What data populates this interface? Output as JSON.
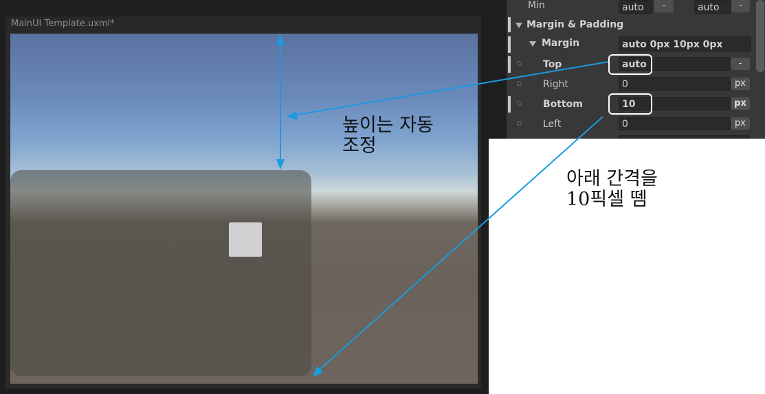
{
  "viewport": {
    "title": "MainUI Template.uxml*"
  },
  "inspector": {
    "min_row": {
      "label": "Min",
      "value1": "auto",
      "button1": "-",
      "value2": "auto",
      "button2": "-"
    },
    "section_title": "Margin & Padding",
    "margin": {
      "label": "Margin",
      "value": "auto 0px 10px 0px",
      "rows": [
        {
          "label": "Top",
          "value": "auto",
          "unit": "-"
        },
        {
          "label": "Right",
          "value": "0",
          "unit": "px"
        },
        {
          "label": "Bottom",
          "value": "10",
          "unit": "px"
        },
        {
          "label": "Left",
          "value": "0",
          "unit": "px"
        }
      ]
    }
  },
  "annotations": {
    "height_note_line1": "높이는 자동",
    "height_note_line2": "조정",
    "bottom_note_line1": "아래 간격을",
    "bottom_note_line2": "10픽셀 뗌"
  },
  "colors": {
    "arrow": "#1a9be0",
    "highlight": "#ffffff",
    "panel_bg": "#383838"
  }
}
